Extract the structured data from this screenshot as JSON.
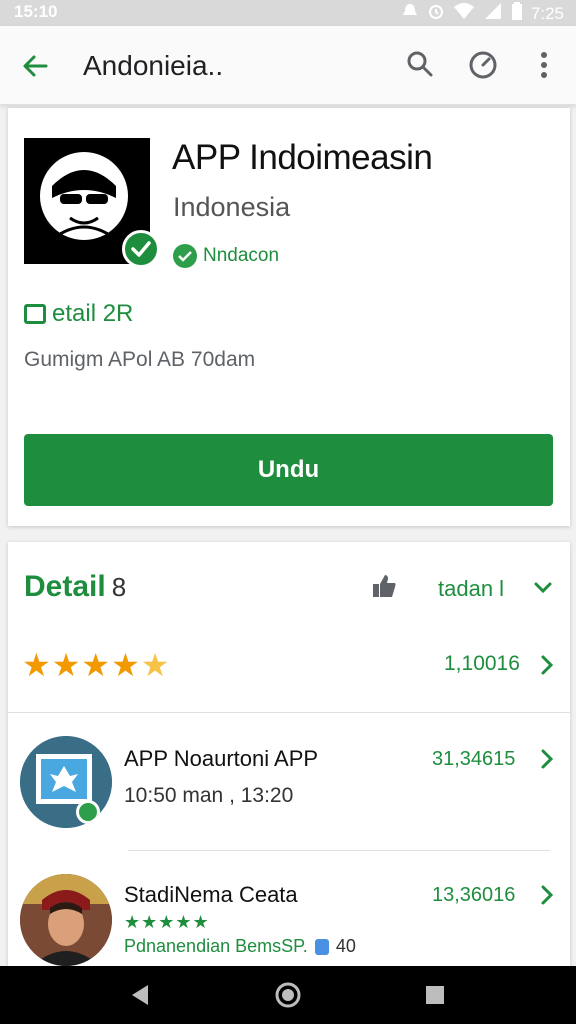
{
  "status_bar": {
    "time_left": "15:10",
    "time_right": "7:25",
    "icons": [
      "notification-icon",
      "alarm-icon",
      "wifi-icon",
      "signal-icon",
      "battery-icon"
    ]
  },
  "app_bar": {
    "title": "Andonieia..",
    "icons": [
      "back-arrow-icon",
      "search-icon",
      "speed-icon",
      "more-vert-icon"
    ]
  },
  "app": {
    "name": "APP Indoimeasin",
    "developer": "Indonesia",
    "verified_label": "Nndacon",
    "detail_label": "etail 2R",
    "info_line": "Gumigm APol AB 70dam",
    "install_label": "Undu"
  },
  "reviews": {
    "title": "Detail",
    "count": "8",
    "sort_label": "tadan l",
    "rating_stars": 4.5,
    "rating_count": "1,10016",
    "items": [
      {
        "title": "APP Noaurtoni  APP",
        "subtitle": "10:50 man , 13:20",
        "count": "31,34615"
      },
      {
        "title": "StadiNema Ceata",
        "stars_text": "★★★★★",
        "extra": "Pdnanendian BemsSP.",
        "extra_num": "40",
        "count": "13,36016"
      }
    ]
  },
  "colors": {
    "accent_green": "#1e8e3e",
    "star_orange": "#f29900",
    "status_bar_bg": "#d9d9d9",
    "nav_bar_bg": "#000000"
  }
}
